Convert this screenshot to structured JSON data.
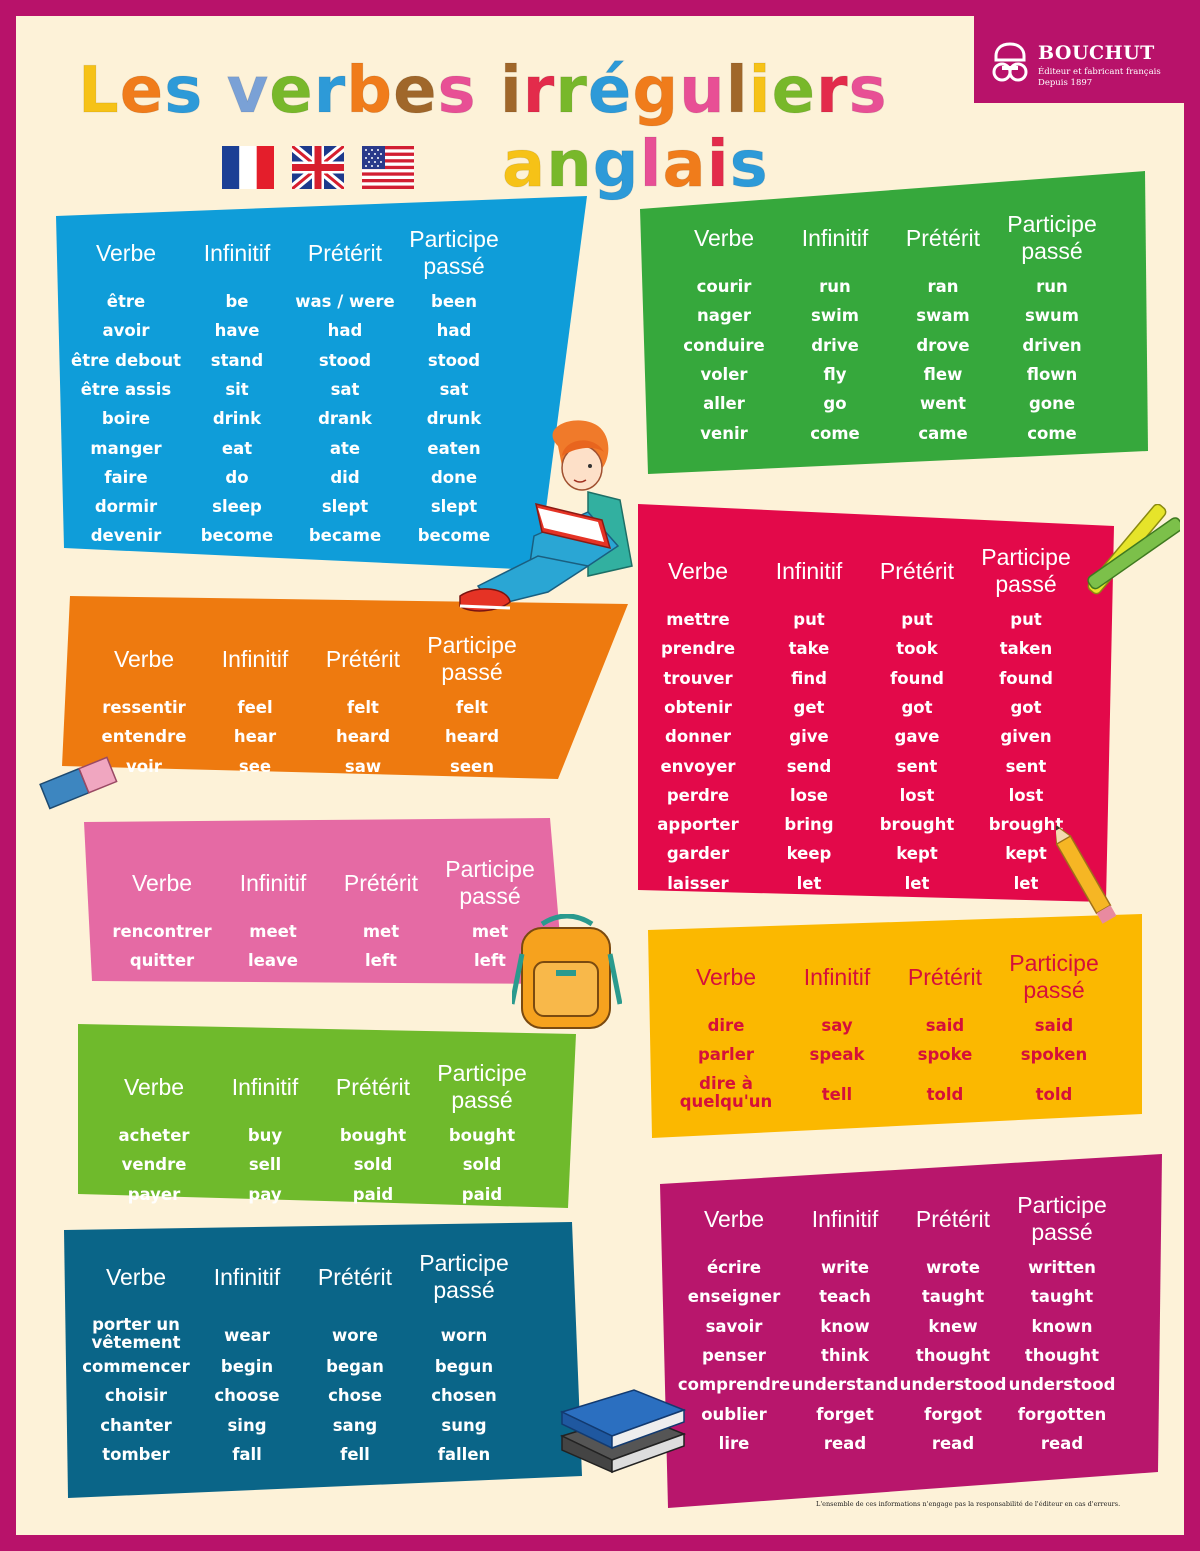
{
  "title": {
    "line1": "Les verbes irréguliers",
    "line2": "anglais"
  },
  "brand": {
    "name": "BOUCHUT",
    "tagline": "Éditeur et fabricant français",
    "since": "Depuis 1897"
  },
  "headers": {
    "verbe": "Verbe",
    "infinitif": "Infinitif",
    "preterit": "Prétérit",
    "participe": "Participe passé"
  },
  "flags": [
    "flag-france-icon",
    "flag-uk-icon",
    "flag-usa-icon"
  ],
  "colors": {
    "frame": "#b8126a",
    "background": "#fdf2d8",
    "blue": "#0f9dd9",
    "green": "#36a83c",
    "orange": "#ee7a0f",
    "red": "#e3094a",
    "pink": "#e56aa4",
    "lime": "#6fba2c",
    "yellow": "#fbb800",
    "teal": "#0a6588",
    "magenta": "#b8166c"
  },
  "tables": [
    {
      "id": "blue",
      "rows": [
        [
          "être",
          "be",
          "was / were",
          "been"
        ],
        [
          "avoir",
          "have",
          "had",
          "had"
        ],
        [
          "être debout",
          "stand",
          "stood",
          "stood"
        ],
        [
          "être assis",
          "sit",
          "sat",
          "sat"
        ],
        [
          "boire",
          "drink",
          "drank",
          "drunk"
        ],
        [
          "manger",
          "eat",
          "ate",
          "eaten"
        ],
        [
          "faire",
          "do",
          "did",
          "done"
        ],
        [
          "dormir",
          "sleep",
          "slept",
          "slept"
        ],
        [
          "devenir",
          "become",
          "became",
          "become"
        ]
      ]
    },
    {
      "id": "green",
      "rows": [
        [
          "courir",
          "run",
          "ran",
          "run"
        ],
        [
          "nager",
          "swim",
          "swam",
          "swum"
        ],
        [
          "conduire",
          "drive",
          "drove",
          "driven"
        ],
        [
          "voler",
          "fly",
          "flew",
          "flown"
        ],
        [
          "aller",
          "go",
          "went",
          "gone"
        ],
        [
          "venir",
          "come",
          "came",
          "come"
        ]
      ]
    },
    {
      "id": "orange",
      "rows": [
        [
          "ressentir",
          "feel",
          "felt",
          "felt"
        ],
        [
          "entendre",
          "hear",
          "heard",
          "heard"
        ],
        [
          "voir",
          "see",
          "saw",
          "seen"
        ]
      ]
    },
    {
      "id": "red",
      "rows": [
        [
          "mettre",
          "put",
          "put",
          "put"
        ],
        [
          "prendre",
          "take",
          "took",
          "taken"
        ],
        [
          "trouver",
          "find",
          "found",
          "found"
        ],
        [
          "obtenir",
          "get",
          "got",
          "got"
        ],
        [
          "donner",
          "give",
          "gave",
          "given"
        ],
        [
          "envoyer",
          "send",
          "sent",
          "sent"
        ],
        [
          "perdre",
          "lose",
          "lost",
          "lost"
        ],
        [
          "apporter",
          "bring",
          "brought",
          "brought"
        ],
        [
          "garder",
          "keep",
          "kept",
          "kept"
        ],
        [
          "laisser",
          "let",
          "let",
          "let"
        ]
      ]
    },
    {
      "id": "pink",
      "rows": [
        [
          "rencontrer",
          "meet",
          "met",
          "met"
        ],
        [
          "quitter",
          "leave",
          "left",
          "left"
        ]
      ]
    },
    {
      "id": "yellow",
      "rows": [
        [
          "dire",
          "say",
          "said",
          "said"
        ],
        [
          "parler",
          "speak",
          "spoke",
          "spoken"
        ],
        [
          "dire à quelqu'un",
          "tell",
          "told",
          "told"
        ]
      ]
    },
    {
      "id": "lime",
      "rows": [
        [
          "acheter",
          "buy",
          "bought",
          "bought"
        ],
        [
          "vendre",
          "sell",
          "sold",
          "sold"
        ],
        [
          "payer",
          "pay",
          "paid",
          "paid"
        ]
      ]
    },
    {
      "id": "teal",
      "rows": [
        [
          "porter un vêtement",
          "wear",
          "wore",
          "worn"
        ],
        [
          "commencer",
          "begin",
          "began",
          "begun"
        ],
        [
          "choisir",
          "choose",
          "chose",
          "chosen"
        ],
        [
          "chanter",
          "sing",
          "sang",
          "sung"
        ],
        [
          "tomber",
          "fall",
          "fell",
          "fallen"
        ]
      ]
    },
    {
      "id": "magenta",
      "rows": [
        [
          "écrire",
          "write",
          "wrote",
          "written"
        ],
        [
          "enseigner",
          "teach",
          "taught",
          "taught"
        ],
        [
          "savoir",
          "know",
          "knew",
          "known"
        ],
        [
          "penser",
          "think",
          "thought",
          "thought"
        ],
        [
          "comprendre",
          "understand",
          "understood",
          "understood"
        ],
        [
          "oublier",
          "forget",
          "forgot",
          "forgotten"
        ],
        [
          "lire",
          "read",
          "read",
          "read"
        ]
      ]
    }
  ],
  "disclaimer": "L'ensemble de ces informations n'engage pas la responsabilité de l'éditeur en cas d'erreurs."
}
